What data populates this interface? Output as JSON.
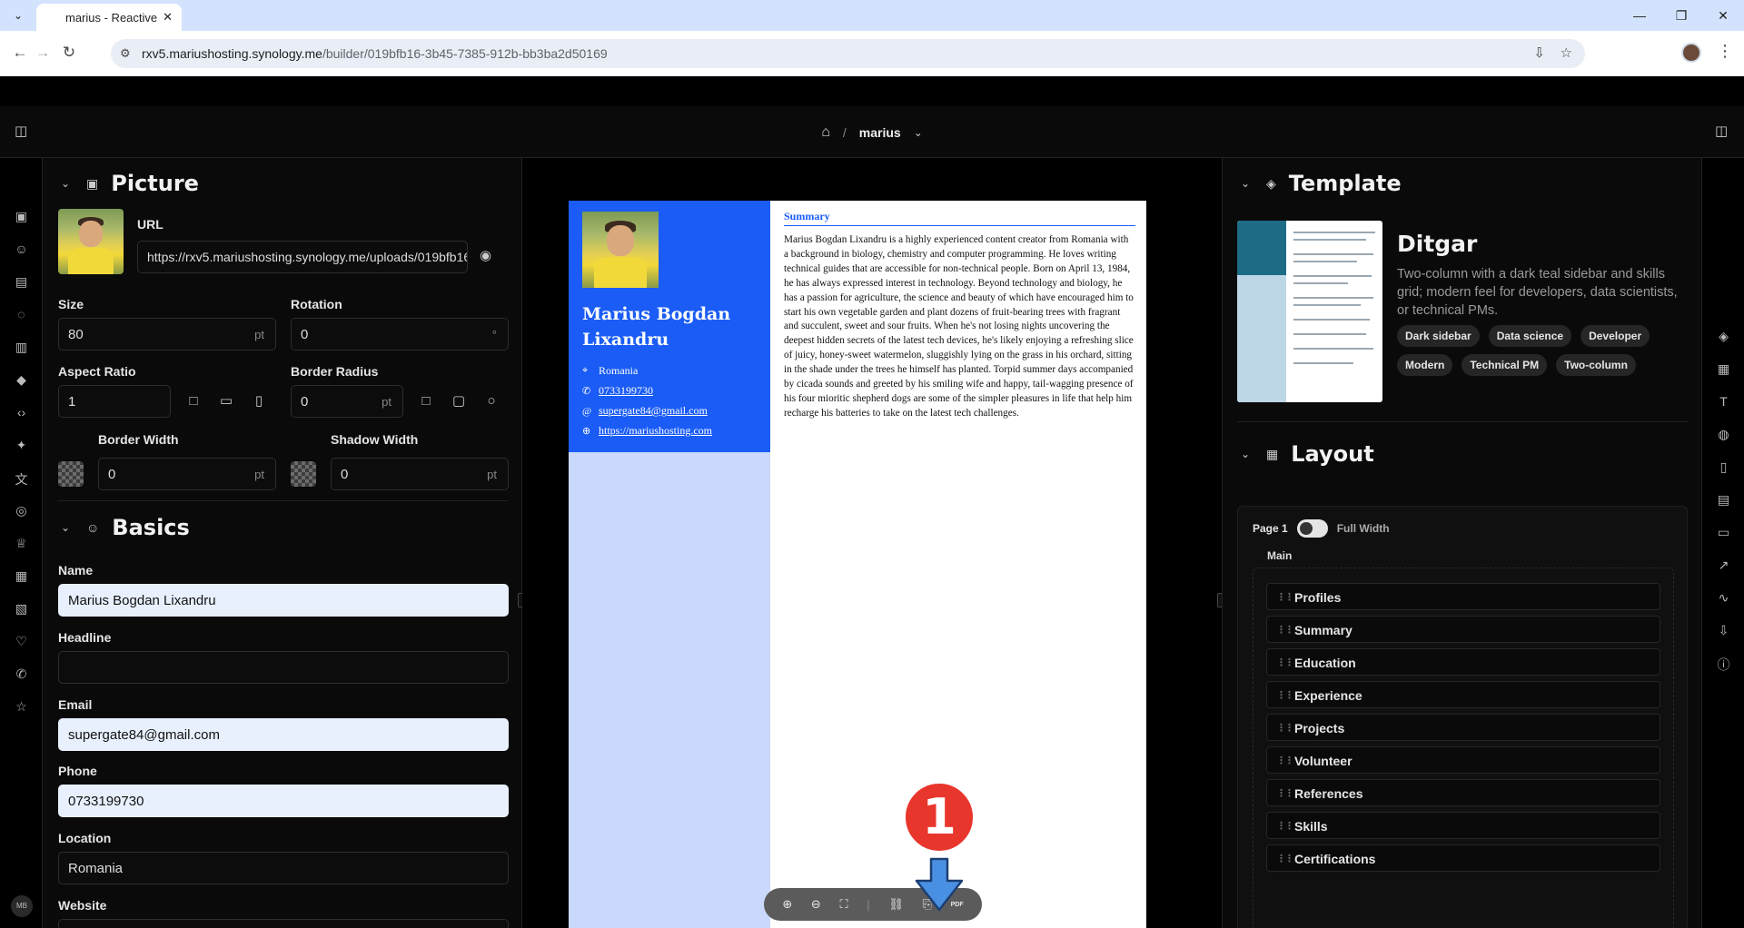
{
  "browser": {
    "tab_title": "marius - Reactive",
    "url_host": "rxv5.mariushosting.synology.me",
    "url_path": "/builder/019bfb16-3b45-7385-912b-bb3ba2d50169"
  },
  "header": {
    "title": "marius",
    "home_icon": "home-icon"
  },
  "left_rail": {
    "icons": [
      "picture-icon",
      "user-icon",
      "summary-icon",
      "profiles-icon",
      "briefcase-icon",
      "graduation-icon",
      "code-icon",
      "skills-icon",
      "languages-icon",
      "interests-icon",
      "awards-icon",
      "certifications-icon",
      "publications-icon",
      "volunteer-icon",
      "references-icon",
      "star-icon"
    ],
    "avatar_initials": "MB"
  },
  "picture": {
    "title": "Picture",
    "url_label": "URL",
    "url_value": "https://rxv5.mariushosting.synology.me/uploads/019bfb16",
    "size_label": "Size",
    "size_value": "80",
    "size_unit": "pt",
    "rotation_label": "Rotation",
    "rotation_value": "0",
    "rotation_unit": "°",
    "aspect_label": "Aspect Ratio",
    "aspect_value": "1",
    "radius_label": "Border Radius",
    "radius_value": "0",
    "radius_unit": "pt",
    "border_width_label": "Border Width",
    "border_width_value": "0",
    "border_width_unit": "pt",
    "shadow_width_label": "Shadow Width",
    "shadow_width_value": "0",
    "shadow_width_unit": "pt"
  },
  "basics": {
    "title": "Basics",
    "name_label": "Name",
    "name_value": "Marius Bogdan Lixandru",
    "headline_label": "Headline",
    "headline_value": "",
    "email_label": "Email",
    "email_value": "supergate84@gmail.com",
    "phone_label": "Phone",
    "phone_value": "0733199730",
    "location_label": "Location",
    "location_value": "Romania",
    "website_label": "Website"
  },
  "resume": {
    "name": "Marius Bogdan Lixandru",
    "location": "Romania",
    "phone": "0733199730",
    "email": "supergate84@gmail.com",
    "website": "https://mariushosting.com",
    "summary_heading": "Summary",
    "summary_text": "Marius Bogdan Lixandru is a highly experienced content creator from Romania with a background in biology, chemistry and computer programming. He loves writing technical guides that are accessible for non-technical people. Born on April 13, 1984, he has always expressed interest in technology. Beyond technology and biology, he has a passion for agriculture, the science and beauty of which have encouraged him to start his own vegetable garden and plant dozens of fruit-bearing trees with fragrant and succulent, sweet and sour fruits. When he's not losing nights uncovering the deepest hidden secrets of the latest tech devices, he's likely enjoying a refreshing slice of juicy, honey-sweet watermelon, sluggishly lying on the grass in his orchard, sitting in the shade under the trees he himself has planted. Torpid summer days accompanied by cicada sounds and greeted by his smiling wife and happy, tail-wagging presence of his four mioritic shepherd dogs are some of the simpler pleasures in life that help him recharge his batteries to take on the latest tech challenges."
  },
  "annotation": {
    "marker": "1"
  },
  "dock": {
    "pdf_label": "PDF"
  },
  "template": {
    "title": "Template",
    "name": "Ditgar",
    "description": "Two-column with a dark teal sidebar and skills grid; modern feel for developers, data scientists, or technical PMs.",
    "tags": [
      "Dark sidebar",
      "Data science",
      "Developer",
      "Modern",
      "Technical PM",
      "Two-column"
    ]
  },
  "layout": {
    "title": "Layout",
    "page_label": "Page 1",
    "full_width_label": "Full Width",
    "full_width_on": true,
    "main_label": "Main",
    "sections": [
      "Profiles",
      "Summary",
      "Education",
      "Experience",
      "Projects",
      "Volunteer",
      "References",
      "Skills",
      "Certifications"
    ]
  },
  "colors": {
    "resume_accent": "#1a5cf5",
    "resume_sidebar": "#c9d8fb",
    "marker": "#e8362d",
    "arrow": "#4a90e2"
  }
}
